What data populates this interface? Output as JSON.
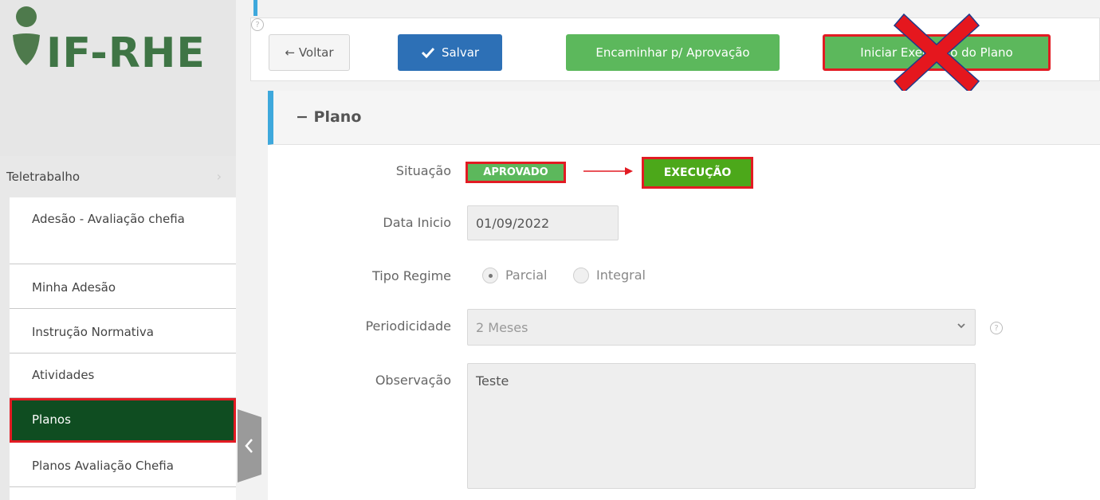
{
  "logo": {
    "text": "IF-RHE"
  },
  "sidebar": {
    "header": {
      "label": "Teletrabalho",
      "chevron": "›"
    },
    "items": [
      {
        "label": "Adesão - Avaliação chefia"
      },
      {
        "label": "Minha Adesão"
      },
      {
        "label": "Instrução Normativa"
      },
      {
        "label": "Atividades"
      },
      {
        "label": "Planos",
        "active": true
      },
      {
        "label": "Planos Avaliação Chefia"
      }
    ],
    "collapse_icon": "chevron-left-icon"
  },
  "toolbar": {
    "back_label": "← Voltar",
    "save_label": "Salvar",
    "help_icon": "?",
    "forward_label": "Encaminhar p/ Aprovação",
    "start_label": "Iniciar Execução do Plano"
  },
  "panel": {
    "title": "− Plano"
  },
  "form": {
    "situacao": {
      "label": "Situação",
      "status": "APROVADO",
      "new_status": "EXECUÇÃO"
    },
    "data_inicio": {
      "label": "Data Inicio",
      "value": "01/09/2022"
    },
    "tipo_regime": {
      "label": "Tipo Regime",
      "options": [
        "Parcial",
        "Integral"
      ],
      "selected": "Parcial"
    },
    "periodicidade": {
      "label": "Periodicidade",
      "value": "2 Meses",
      "help_icon": "?"
    },
    "observacao": {
      "label": "Observação",
      "value": "Teste"
    }
  },
  "colors": {
    "brand_green": "#3f7545",
    "active_menu": "#0f4d21",
    "primary": "#2d70b6",
    "success": "#5cb85c",
    "highlight_red": "#e21b23",
    "accent_blue": "#3ea8dc"
  }
}
